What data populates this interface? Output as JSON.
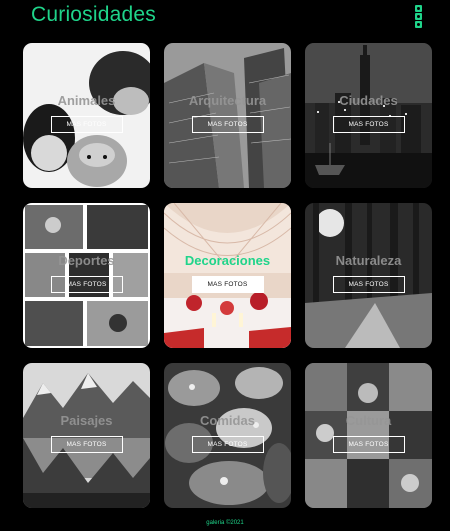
{
  "header": {
    "title": "Curiosidades",
    "social_icons": [
      "facebook-icon",
      "twitter-icon",
      "instagram-icon"
    ]
  },
  "gallery": {
    "cards": [
      {
        "title": "Animales",
        "button": "MAS FOTOS",
        "active": false
      },
      {
        "title": "Arquitectura",
        "button": "MAS FOTOS",
        "active": false
      },
      {
        "title": "Ciudades",
        "button": "MAS FOTOS",
        "active": false
      },
      {
        "title": "Deportes",
        "button": "MAS FOTOS",
        "active": false
      },
      {
        "title": "Decoraciones",
        "button": "MAS FOTOS",
        "active": true
      },
      {
        "title": "Naturaleza",
        "button": "MAS FOTOS",
        "active": false
      },
      {
        "title": "Paisajes",
        "button": "MAS FOTOS",
        "active": false
      },
      {
        "title": "Comidas",
        "button": "MAS FOTOS",
        "active": false
      },
      {
        "title": "Cultura",
        "button": "MAS FOTOS",
        "active": false
      }
    ]
  },
  "footer": {
    "text": "galeria ©2021"
  },
  "colors": {
    "accent": "#1fd48a",
    "background": "#000000"
  }
}
